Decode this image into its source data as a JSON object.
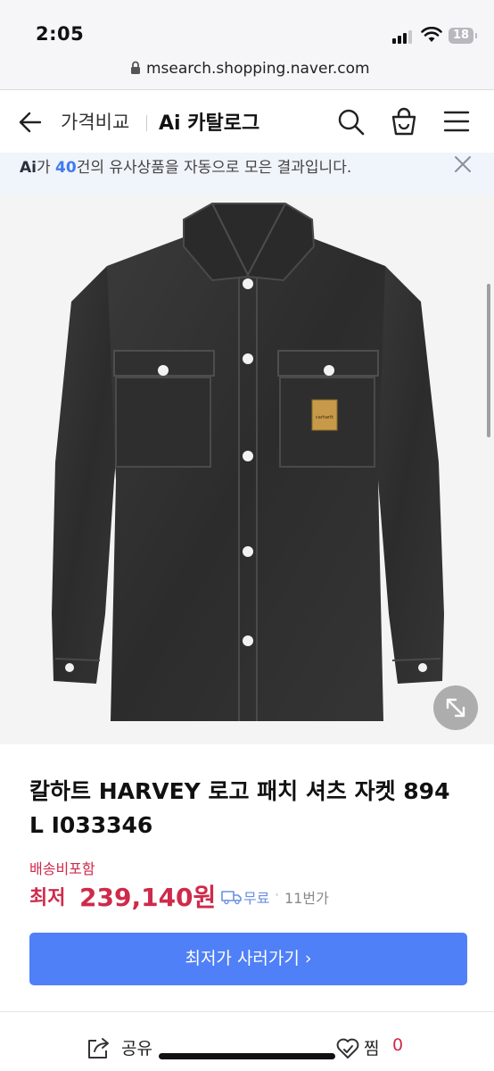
{
  "status_bar": {
    "time": "2:05",
    "battery": "18"
  },
  "browser": {
    "url": "msearch.shopping.naver.com"
  },
  "header": {
    "price_compare": "가격비교",
    "ai_catalog": "Ai 카탈로그"
  },
  "ai_banner": {
    "ai": "Ai",
    "pre": "가 ",
    "count": "40",
    "post": "건의 유사상품을 자동으로 모은 결과입니다."
  },
  "product": {
    "image_logo_text": "carhartt",
    "title": "칼하트 HARVEY 로고 패치 셔츠 자켓 894 L I033346",
    "shipping": "배송비포함",
    "price_label": "최저",
    "price": "239,140원",
    "delivery": "무료",
    "sellers": "11번가",
    "cta": "최저가 사러가기 ›"
  },
  "bottom_bar": {
    "share": "공유",
    "wish": "찜",
    "wish_count": "0"
  },
  "colors": {
    "accent": "#4f80f7",
    "price": "#cf2a4b",
    "ai_count": "#3d7bf2"
  }
}
